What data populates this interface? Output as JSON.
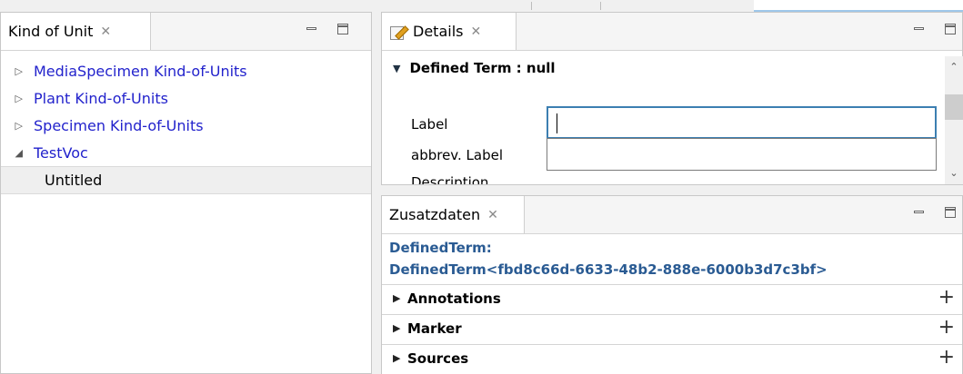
{
  "kind_of_unit_panel": {
    "tab_title": "Kind of Unit",
    "tab_close": "✕",
    "tree": [
      {
        "label": "MediaSpecimen Kind-of-Units",
        "arrow": "▷",
        "blue": true
      },
      {
        "label": "Plant Kind-of-Units",
        "arrow": "▷",
        "blue": true
      },
      {
        "label": "Specimen Kind-of-Units",
        "arrow": "▷",
        "blue": true
      },
      {
        "label": "TestVoc",
        "arrow": "◢",
        "blue": true
      },
      {
        "label": "Untitled",
        "arrow": "",
        "blue": false
      }
    ]
  },
  "details_panel": {
    "tab_title": "Details",
    "tab_close": "✕",
    "section_title": "Defined Term : null",
    "section_arrow": "▼",
    "fields": [
      {
        "label": "Label",
        "value": ""
      },
      {
        "label": "abbrev. Label",
        "value": ""
      },
      {
        "label": "Description"
      }
    ],
    "scroll_up": "⌃",
    "scroll_down": "⌄"
  },
  "zusatzdaten_panel": {
    "tab_title": "Zusatzdaten",
    "tab_close": "✕",
    "defined_term_line1": "DefinedTerm:",
    "defined_term_line2": "DefinedTerm<fbd8c66d-6633-48b2-888e-6000b3d7c3bf>",
    "sections": [
      {
        "label": "Annotations",
        "arrow": "▶",
        "plus": "+"
      },
      {
        "label": "Marker",
        "arrow": "▶",
        "plus": "+"
      },
      {
        "label": "Sources",
        "arrow": "▶",
        "plus": "+"
      }
    ]
  },
  "colors": {
    "link_blue": "#2222cc",
    "term_blue": "#2a5b93",
    "focus_border": "#3c7fb1"
  }
}
